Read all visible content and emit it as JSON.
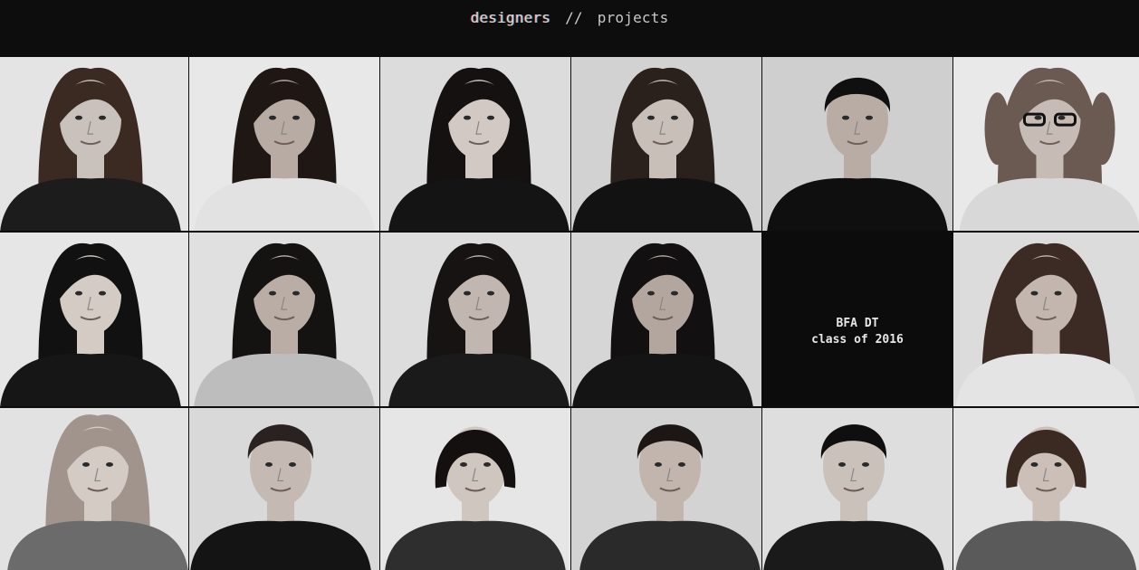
{
  "nav": {
    "designers_label": "designers",
    "separator": "//",
    "projects_label": "projects"
  },
  "feature": {
    "line1": "BFA DT",
    "line2": "class of 2016"
  },
  "colors": {
    "background": "#0d0d0d",
    "nav_text": "#c9c9c9",
    "tile_bg": "#d9d9d9",
    "feature_bg": "#0c0c0c"
  },
  "portraits": [
    {
      "row": 0,
      "col": 0,
      "hair": "#3a2a22",
      "shirt": "#1c1c1c",
      "skin": "#c9c1bb",
      "bg": "#e4e4e4",
      "style": "long"
    },
    {
      "row": 0,
      "col": 1,
      "hair": "#1f1713",
      "shirt": "#e2e2e2",
      "skin": "#b8aba4",
      "bg": "#e8e8e8",
      "style": "long"
    },
    {
      "row": 0,
      "col": 2,
      "hair": "#151111",
      "shirt": "#141414",
      "skin": "#d2c9c4",
      "bg": "#dcdcdc",
      "style": "long"
    },
    {
      "row": 0,
      "col": 3,
      "hair": "#2a201c",
      "shirt": "#121212",
      "skin": "#c9bfb9",
      "bg": "#d2d2d2",
      "style": "long"
    },
    {
      "row": 0,
      "col": 4,
      "hair": "#101010",
      "shirt": "#0f0f0f",
      "skin": "#b8aca5",
      "bg": "#cfcfcf",
      "style": "short"
    },
    {
      "row": 0,
      "col": 5,
      "hair": "#6a5a52",
      "shirt": "#d8d8d8",
      "skin": "#c7bcb5",
      "bg": "#e9e9e9",
      "style": "pigtails"
    },
    {
      "row": 1,
      "col": 0,
      "hair": "#111111",
      "shirt": "#161616",
      "skin": "#d4cbc5",
      "bg": "#e6e6e6",
      "style": "long"
    },
    {
      "row": 1,
      "col": 1,
      "hair": "#151212",
      "shirt": "#bdbdbd",
      "skin": "#b9ada6",
      "bg": "#e0e0e0",
      "style": "long"
    },
    {
      "row": 1,
      "col": 2,
      "hair": "#171313",
      "shirt": "#1a1a1a",
      "skin": "#c2b7b0",
      "bg": "#dddddd",
      "style": "long"
    },
    {
      "row": 1,
      "col": 3,
      "hair": "#121010",
      "shirt": "#141414",
      "skin": "#b3a69f",
      "bg": "#d6d6d6",
      "style": "long"
    },
    {
      "row": 1,
      "col": 5,
      "hair": "#3b2b24",
      "shirt": "#e4e4e4",
      "skin": "#c3b6ae",
      "bg": "#dcdcdc",
      "style": "curly"
    },
    {
      "row": 2,
      "col": 0,
      "hair": "#a0948c",
      "shirt": "#6b6b6b",
      "skin": "#d4cbc5",
      "bg": "#e2e2e2",
      "style": "long"
    },
    {
      "row": 2,
      "col": 1,
      "hair": "#2a2220",
      "shirt": "#141414",
      "skin": "#c5bab3",
      "bg": "#d9d9d9",
      "style": "short"
    },
    {
      "row": 2,
      "col": 2,
      "hair": "#141010",
      "shirt": "#2e2e2e",
      "skin": "#d0c6c0",
      "bg": "#e6e6e6",
      "style": "bob"
    },
    {
      "row": 2,
      "col": 3,
      "hair": "#1c1614",
      "shirt": "#2a2a2a",
      "skin": "#c1b5ae",
      "bg": "#d3d3d3",
      "style": "short"
    },
    {
      "row": 2,
      "col": 4,
      "hair": "#0f0f0f",
      "shirt": "#1a1a1a",
      "skin": "#cbc1bb",
      "bg": "#dedede",
      "style": "short"
    },
    {
      "row": 2,
      "col": 5,
      "hair": "#3a2a22",
      "shirt": "#5a5a5a",
      "skin": "#cbbfb8",
      "bg": "#e4e4e4",
      "style": "bob"
    }
  ]
}
